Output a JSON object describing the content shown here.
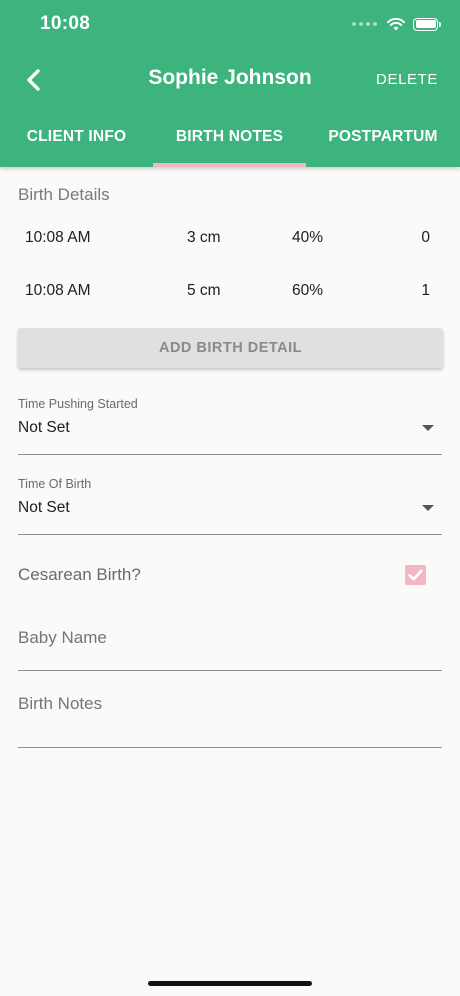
{
  "status_bar": {
    "time": "10:08"
  },
  "header": {
    "title": "Sophie Johnson",
    "delete_label": "DELETE"
  },
  "tabs": [
    {
      "label": "CLIENT INFO",
      "active": false
    },
    {
      "label": "BIRTH NOTES",
      "active": true
    },
    {
      "label": "POSTPARTUM",
      "active": false
    }
  ],
  "birth_details": {
    "title": "Birth Details",
    "rows": [
      {
        "time": "10:08 AM",
        "dilation": "3 cm",
        "effacement": "40%",
        "station": "0"
      },
      {
        "time": "10:08 AM",
        "dilation": "5 cm",
        "effacement": "60%",
        "station": "1"
      }
    ],
    "add_button_label": "ADD BIRTH DETAIL"
  },
  "form": {
    "time_pushing": {
      "label": "Time Pushing Started",
      "value": "Not Set"
    },
    "time_of_birth": {
      "label": "Time Of Birth",
      "value": "Not Set"
    },
    "cesarean": {
      "label": "Cesarean Birth?",
      "checked": true
    },
    "baby_name": {
      "placeholder": "Baby Name"
    },
    "birth_notes": {
      "placeholder": "Birth Notes"
    }
  },
  "colors": {
    "primary": "#3db47e",
    "accent": "#f4b6c2",
    "background": "#fafafa"
  }
}
